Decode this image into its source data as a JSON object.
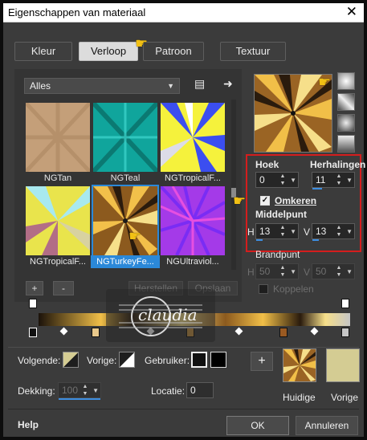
{
  "title": "Eigenschappen van materiaal",
  "close_glyph": "✕",
  "tabs": [
    {
      "label": "Kleur"
    },
    {
      "label": "Verloop"
    },
    {
      "label": "Patroon"
    },
    {
      "label": "Textuur"
    }
  ],
  "library": {
    "dropdown_value": "Alles",
    "items": [
      {
        "name": "NGTan",
        "colors": [
          "#c9a37d",
          "#a8835d"
        ]
      },
      {
        "name": "NGTeal",
        "colors": [
          "#0fa9a0",
          "#0a6c66"
        ]
      },
      {
        "name": "NGTropicalF...",
        "colors": [
          "#f6f23a",
          "#3a4df0"
        ]
      },
      {
        "name": "NGTropicalF...",
        "colors": [
          "#e8e24a",
          "#b26d87"
        ]
      },
      {
        "name": "NGTurkeyFe...",
        "colors": [
          "#f0b445",
          "#2a1a0c"
        ]
      },
      {
        "name": "NGUltraviol...",
        "colors": [
          "#b038e6",
          "#6d2cf2"
        ]
      }
    ],
    "selected_index": 4,
    "add_label": "+",
    "remove_label": "-",
    "restore_label": "Herstellen",
    "save_label": "Opslaan"
  },
  "settings": {
    "angle_label": "Hoek",
    "angle_value": "0",
    "repeats_label": "Herhalingen",
    "repeats_value": "11",
    "invert_label": "Omkeren",
    "invert_checked": true,
    "center_label": "Middelpunt",
    "center_h_label": "H",
    "center_h": "13",
    "center_v_label": "V",
    "center_v": "13",
    "focus_label": "Brandpunt",
    "focus_h_label": "H",
    "focus_h": "50",
    "focus_v_label": "V",
    "focus_v": "50",
    "link_label": "Koppelen"
  },
  "editor": {
    "next_label": "Volgende:",
    "prev_label": "Vorige:",
    "user_label": "Gebruiker:",
    "opacity_label": "Dekking:",
    "opacity_value": "100",
    "location_label": "Locatie:",
    "location_value": "0"
  },
  "previews": {
    "current_label": "Huidige",
    "previous_label": "Vorige",
    "previous_color": "#d4cc93"
  },
  "watermark": "claudia",
  "footer": {
    "help_label": "Help",
    "ok_label": "OK",
    "cancel_label": "Annuleren"
  },
  "colors": {
    "accent": "#2b88d8",
    "highlight_box": "#d41d1d"
  }
}
